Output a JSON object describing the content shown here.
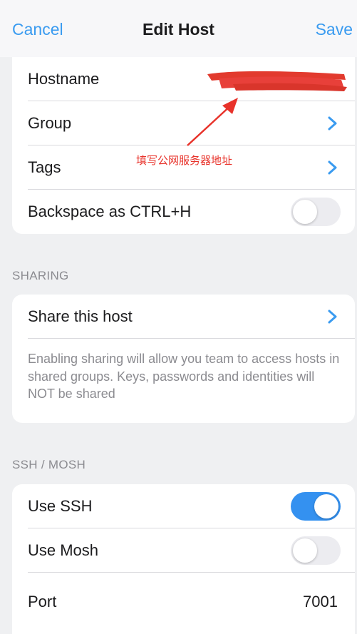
{
  "nav": {
    "cancel_label": "Cancel",
    "title": "Edit Host",
    "save_label": "Save"
  },
  "general": {
    "hostname_label": "Hostname",
    "group_label": "Group",
    "tags_label": "Tags",
    "backspace_label": "Backspace as CTRL+H",
    "backspace_enabled": false
  },
  "annotation": {
    "text": "填写公网服务器地址",
    "color": "#e8322a"
  },
  "sharing": {
    "header": "SHARING",
    "share_label": "Share this host",
    "note": "Enabling sharing will allow you team to access hosts in shared groups. Keys, passwords and identities will NOT be shared"
  },
  "ssh": {
    "header": "SSH / MOSH",
    "use_ssh_label": "Use SSH",
    "use_ssh_enabled": true,
    "use_mosh_label": "Use Mosh",
    "use_mosh_enabled": false,
    "port_label": "Port",
    "port_value": "7001"
  },
  "colors": {
    "accent": "#3a9bf0",
    "toggle_on": "#3491f0",
    "background": "#eff0f2"
  }
}
